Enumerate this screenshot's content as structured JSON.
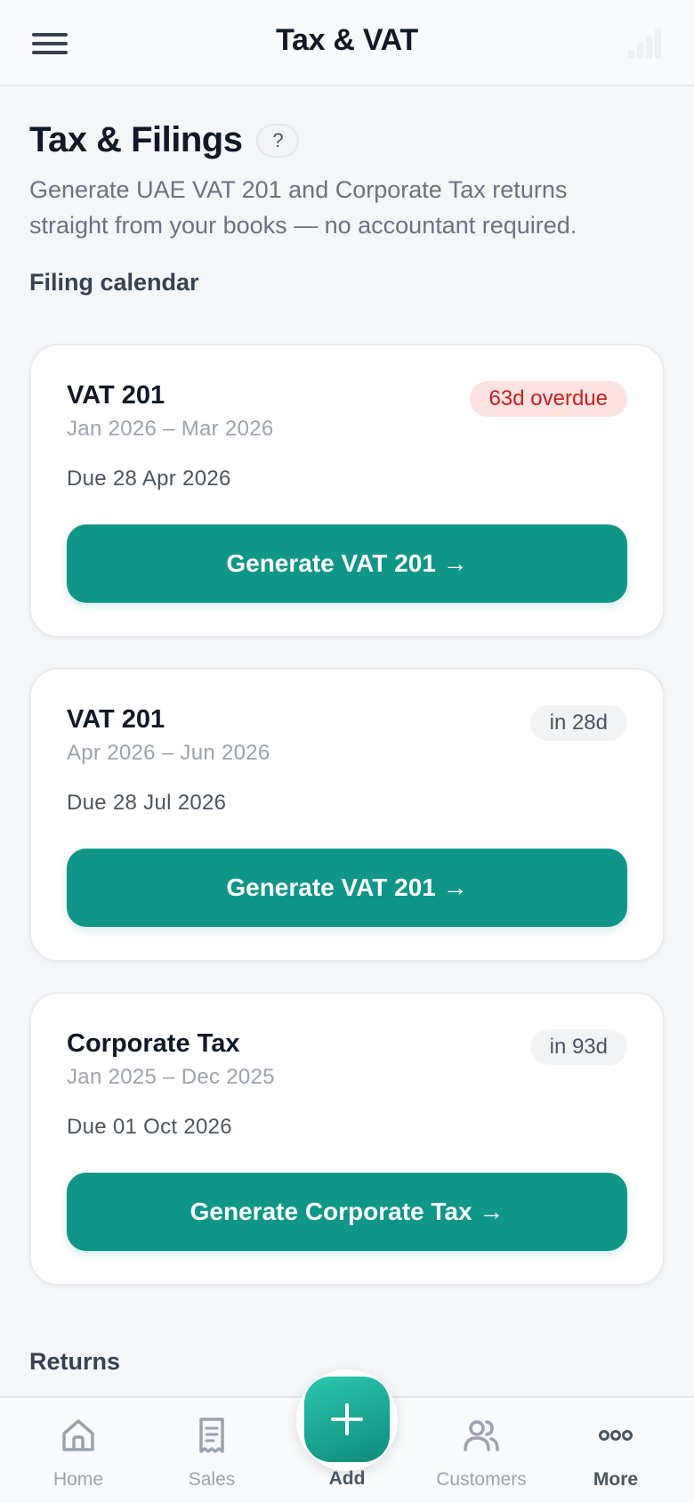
{
  "header": {
    "title": "Tax & VAT"
  },
  "page": {
    "title": "Tax & Filings",
    "help_label": "?",
    "description": "Generate UAE VAT 201 and Corporate Tax returns straight from your books — no accountant required."
  },
  "filing_calendar": {
    "label": "Filing calendar",
    "filings": [
      {
        "name": "VAT 201",
        "period": "Jan 2026 – Mar 2026",
        "due": "Due 28 Apr 2026",
        "status": "63d overdue",
        "status_type": "overdue",
        "button": "Generate VAT 201 →"
      },
      {
        "name": "VAT 201",
        "period": "Apr 2026 – Jun 2026",
        "due": "Due 28 Jul 2026",
        "status": "in 28d",
        "status_type": "upcoming",
        "button": "Generate VAT 201 →"
      },
      {
        "name": "Corporate Tax",
        "period": "Jan 2025 – Dec 2025",
        "due": "Due 01 Oct 2026",
        "status": "in 93d",
        "status_type": "upcoming",
        "button": "Generate Corporate Tax →"
      }
    ]
  },
  "returns": {
    "label": "Returns"
  },
  "bottom_nav": {
    "items": [
      {
        "label": "Home",
        "icon": "home-icon"
      },
      {
        "label": "Sales",
        "icon": "receipt-icon"
      },
      {
        "label": "Add",
        "icon": "plus-icon"
      },
      {
        "label": "Customers",
        "icon": "users-icon"
      },
      {
        "label": "More",
        "icon": "more-icon",
        "active": true
      }
    ]
  },
  "colors": {
    "primary": "#0f9688",
    "overdue_bg": "#fde2e2",
    "overdue_text": "#c81e1e",
    "page_bg": "#f4f6f8"
  }
}
